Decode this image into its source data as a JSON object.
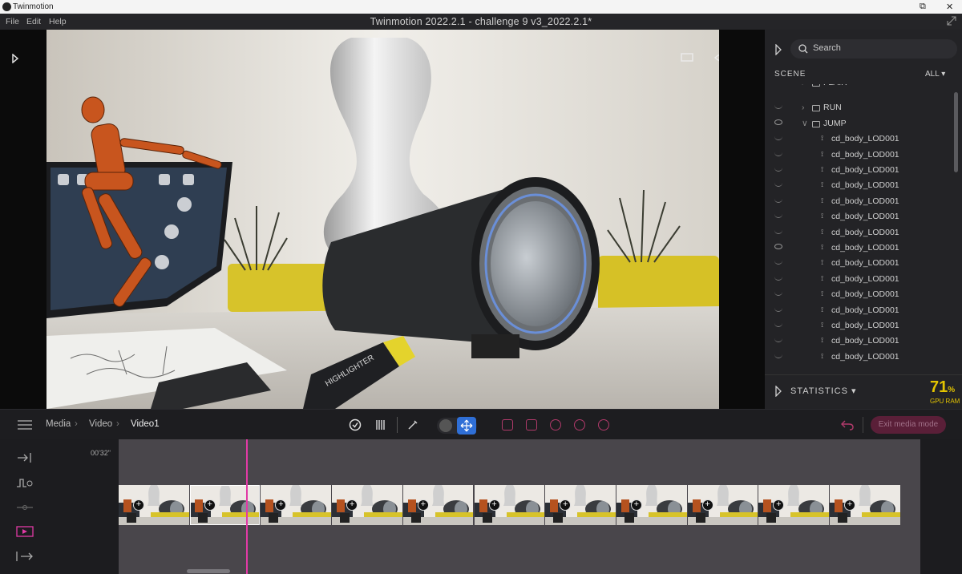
{
  "os": {
    "app_name": "Twinmotion"
  },
  "menu": {
    "items": [
      "File",
      "Edit",
      "Help"
    ],
    "window_title": "Twinmotion 2022.2.1 - challenge 9 v3_2022.2.1*"
  },
  "scene_panel": {
    "search_placeholder": "Search",
    "scene_label": "SCENE",
    "filter_label": "ALL",
    "tree": [
      {
        "label": "FLAIR",
        "visible": false,
        "type": "folder",
        "partial": true
      },
      {
        "label": "RUN",
        "visible": false,
        "type": "folder"
      },
      {
        "label": "JUMP",
        "visible": true,
        "type": "folder",
        "expanded": true
      },
      {
        "label": "cd_body_LOD001",
        "visible": false,
        "type": "mesh"
      },
      {
        "label": "cd_body_LOD001",
        "visible": false,
        "type": "mesh"
      },
      {
        "label": "cd_body_LOD001",
        "visible": false,
        "type": "mesh"
      },
      {
        "label": "cd_body_LOD001",
        "visible": false,
        "type": "mesh"
      },
      {
        "label": "cd_body_LOD001",
        "visible": false,
        "type": "mesh"
      },
      {
        "label": "cd_body_LOD001",
        "visible": false,
        "type": "mesh"
      },
      {
        "label": "cd_body_LOD001",
        "visible": false,
        "type": "mesh"
      },
      {
        "label": "cd_body_LOD001",
        "visible": true,
        "type": "mesh"
      },
      {
        "label": "cd_body_LOD001",
        "visible": false,
        "type": "mesh"
      },
      {
        "label": "cd_body_LOD001",
        "visible": false,
        "type": "mesh"
      },
      {
        "label": "cd_body_LOD001",
        "visible": false,
        "type": "mesh"
      },
      {
        "label": "cd_body_LOD001",
        "visible": false,
        "type": "mesh"
      },
      {
        "label": "cd_body_LOD001",
        "visible": false,
        "type": "mesh"
      },
      {
        "label": "cd_body_LOD001",
        "visible": false,
        "type": "mesh"
      },
      {
        "label": "cd_body_LOD001",
        "visible": false,
        "type": "mesh"
      }
    ],
    "statistics_label": "STATISTICS",
    "gpu_value": "71",
    "gpu_unit": "%",
    "gpu_label": "GPU RAM"
  },
  "toolbar": {
    "breadcrumb": [
      "Media",
      "Video",
      "Video1"
    ],
    "exit_button": "Exit media mode"
  },
  "timeline": {
    "time_label": "00'32\"",
    "clip_count": 11,
    "selected_clip": 2
  },
  "colors": {
    "accent": "#e23aa6",
    "gpu_yellow": "#e3c400",
    "selection_blue": "#2f6fd6",
    "mode_pink": "#b03a6a"
  }
}
